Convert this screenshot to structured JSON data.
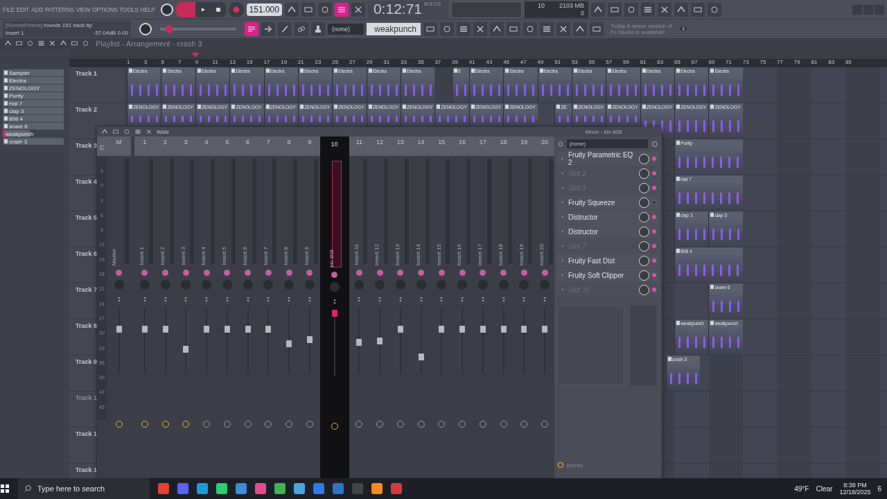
{
  "menu": [
    "FILE",
    "EDIT",
    "ADD",
    "PATTERNS",
    "VIEW",
    "OPTIONS",
    "TOOLS",
    "HELP"
  ],
  "transport": {
    "tempo": "151.000",
    "time": "0:12:71",
    "time_unit": "M:S:CS"
  },
  "snap_toggles": [
    {
      "on": false
    },
    {
      "on": false
    },
    {
      "on": false
    },
    {
      "on": true
    },
    {
      "on": false
    }
  ],
  "tool_toggles": [
    {
      "on": true
    },
    {
      "on": false
    },
    {
      "on": false
    },
    {
      "on": false
    },
    {
      "on": false
    }
  ],
  "pitch": {
    "level": 0.12
  },
  "cpu": {
    "voices": "10",
    "memory": "2103 MB",
    "polyphony": "0"
  },
  "info": {
    "user": "[RonniePeters]",
    "file": "rounds 151 back.flp",
    "target": "Insert 1",
    "db": "-57.04dB",
    "pan": "0.00"
  },
  "pattern_selector": {
    "value": "(none)"
  },
  "channel_selector": {
    "value": "weakpunch"
  },
  "news": {
    "label": "Today",
    "message": "A newer version of FL Studio is available!",
    "badge": "3"
  },
  "playlist": {
    "title": "Playlist - Arrangement - crash 3",
    "ruler": [
      "1",
      "3",
      "5",
      "7",
      "9",
      "11",
      "13",
      "15",
      "17",
      "19",
      "21",
      "23",
      "25",
      "27",
      "29",
      "31",
      "33",
      "35",
      "37",
      "39",
      "41",
      "43",
      "45",
      "47",
      "49",
      "51",
      "53",
      "55",
      "57",
      "59",
      "61",
      "63",
      "65",
      "67",
      "69",
      "71",
      "73",
      "75",
      "77",
      "79",
      "81",
      "83",
      "85"
    ],
    "channels": [
      {
        "name": "Sampler",
        "selected": false
      },
      {
        "name": "Electra",
        "selected": false
      },
      {
        "name": "ZENOLOGY",
        "selected": false
      },
      {
        "name": "Purity",
        "selected": false
      },
      {
        "name": "Hat 7",
        "selected": false
      },
      {
        "name": "clap 3",
        "selected": false
      },
      {
        "name": "808 4",
        "selected": false
      },
      {
        "name": "snare 6",
        "selected": false
      },
      {
        "name": "weakpunch",
        "selected": true
      },
      {
        "name": "crash 3",
        "selected": false
      }
    ],
    "tracks": [
      {
        "name": "Track 1",
        "muted": false,
        "clips": [
          "Electra",
          "Electra",
          "Electra",
          "Electra",
          "Electra",
          "Electra",
          "Electra",
          "Electra",
          "Electra",
          "E",
          "Electra",
          "Electra",
          "Electra",
          "Electra",
          "Electra",
          "Electra",
          "Electra",
          "Electra"
        ]
      },
      {
        "name": "Track 2",
        "muted": false,
        "clips": [
          "ZENOLOGY",
          "ZENOLOGY",
          "ZENOLOGY",
          "ZENOLOGY",
          "ZENOLOGY",
          "ZENOLOGY",
          "ZENOLOGY",
          "ZENOLOGY",
          "ZENOLOGY",
          "ZENOLOGY",
          "ZENOLOGY",
          "ZENOLOGY",
          "ZE",
          "ZENOLOGY",
          "ZENOLOGY",
          "ZENOLOGY",
          "ZENOLOGY",
          "ZENOLOGY"
        ]
      },
      {
        "name": "Track 3",
        "muted": false,
        "clips": [
          "Purity"
        ]
      },
      {
        "name": "Track 4",
        "muted": false,
        "clips": [
          "Hat 7"
        ]
      },
      {
        "name": "Track 5",
        "muted": false,
        "clips": [
          "clap 3",
          "clap 3"
        ]
      },
      {
        "name": "Track 6",
        "muted": false,
        "clips": [
          "808 4"
        ]
      },
      {
        "name": "Track 7",
        "muted": false,
        "clips": [
          "snare 6"
        ]
      },
      {
        "name": "Track 8",
        "muted": false,
        "clips": [
          "weakpunch",
          "weakpunch"
        ]
      },
      {
        "name": "Track 9",
        "muted": false,
        "clips": [
          "crash 3"
        ]
      },
      {
        "name": "Track 1",
        "muted": true
      },
      {
        "name": "Track 1",
        "muted": false
      },
      {
        "name": "Track 1",
        "muted": false
      }
    ]
  },
  "mixer": {
    "toolbar_label": "Wide",
    "title": "Mixer - kin 808",
    "column_c": "C",
    "scale": [
      "3",
      "0",
      "3",
      "6",
      "9",
      "12",
      "15",
      "18",
      "21",
      "24",
      "27",
      "30",
      "33",
      "36",
      "39",
      "42",
      "45"
    ],
    "master": {
      "number": "M",
      "name": "Master",
      "level": 0.7,
      "routed": true,
      "enabled": true
    },
    "inserts": [
      {
        "number": "1",
        "name": "Insert 1",
        "level": 0.7,
        "routed": true,
        "enabled": true,
        "selected": false
      },
      {
        "number": "2",
        "name": "Insert 2",
        "level": 0.7,
        "routed": true,
        "enabled": true,
        "selected": false
      },
      {
        "number": "3",
        "name": "Insert 3",
        "level": 0.35,
        "routed": true,
        "enabled": true,
        "selected": false
      },
      {
        "number": "4",
        "name": "Insert 4",
        "level": 0.7,
        "routed": false,
        "enabled": true,
        "selected": false
      },
      {
        "number": "5",
        "name": "Insert 5",
        "level": 0.7,
        "routed": false,
        "enabled": true,
        "selected": false
      },
      {
        "number": "6",
        "name": "Insert 6",
        "level": 0.7,
        "routed": false,
        "enabled": true,
        "selected": false
      },
      {
        "number": "7",
        "name": "Insert 7",
        "level": 0.7,
        "routed": false,
        "enabled": true,
        "selected": false
      },
      {
        "number": "8",
        "name": "Insert 8",
        "level": 0.45,
        "routed": false,
        "enabled": true,
        "selected": false
      },
      {
        "number": "9",
        "name": "Insert 9",
        "level": 0.52,
        "routed": false,
        "enabled": true,
        "selected": false
      },
      {
        "number": "10",
        "name": "kin 808",
        "level": 1,
        "routed": true,
        "enabled": true,
        "selected": true
      },
      {
        "number": "11",
        "name": "Insert 11",
        "level": 0.47,
        "routed": false,
        "enabled": true,
        "selected": false
      },
      {
        "number": "12",
        "name": "Insert 12",
        "level": 0.49,
        "routed": false,
        "enabled": true,
        "selected": false
      },
      {
        "number": "13",
        "name": "Insert 13",
        "level": 0.7,
        "routed": false,
        "enabled": true,
        "selected": false
      },
      {
        "number": "14",
        "name": "Insert 14",
        "level": 0.22,
        "routed": false,
        "enabled": true,
        "selected": false
      },
      {
        "number": "15",
        "name": "Insert 15",
        "level": 0.7,
        "routed": false,
        "enabled": true,
        "selected": false
      },
      {
        "number": "16",
        "name": "Insert 16",
        "level": 0.7,
        "routed": false,
        "enabled": true,
        "selected": false
      },
      {
        "number": "17",
        "name": "Insert 17",
        "level": 0.7,
        "routed": false,
        "enabled": true,
        "selected": false
      },
      {
        "number": "18",
        "name": "Insert 18",
        "level": 0.7,
        "routed": false,
        "enabled": true,
        "selected": false
      },
      {
        "number": "19",
        "name": "Insert 19",
        "level": 0.7,
        "routed": false,
        "enabled": true,
        "selected": false
      },
      {
        "number": "20",
        "name": "Insert 20",
        "level": 0.7,
        "routed": false,
        "enabled": true,
        "selected": false
      }
    ],
    "effects_input": "(none)",
    "slots": [
      {
        "kind": "effect",
        "name": "Fruity Parametric EQ 2",
        "on": true
      },
      {
        "kind": "empty",
        "name": "Slot 2",
        "on": true
      },
      {
        "kind": "empty",
        "name": "Slot 3",
        "on": true
      },
      {
        "kind": "effect",
        "name": "Fruity Squeeze",
        "on": false
      },
      {
        "kind": "effect",
        "name": "Distructor",
        "on": true
      },
      {
        "kind": "effect",
        "name": "Distructor",
        "on": true
      },
      {
        "kind": "empty",
        "name": "Slot 7",
        "on": true
      },
      {
        "kind": "effect",
        "name": "Fruity Fast Dist",
        "on": true
      },
      {
        "kind": "effect",
        "name": "Fruity Soft Clipper",
        "on": true
      },
      {
        "kind": "empty",
        "name": "Slot 10",
        "on": true
      }
    ],
    "output": "(none)"
  },
  "taskbar": {
    "search_placeholder": "Type here to search",
    "temperature": "49°F",
    "weather": "Clear",
    "time": "8:38 PM",
    "date": "12/18/2025",
    "notifications": "6"
  }
}
